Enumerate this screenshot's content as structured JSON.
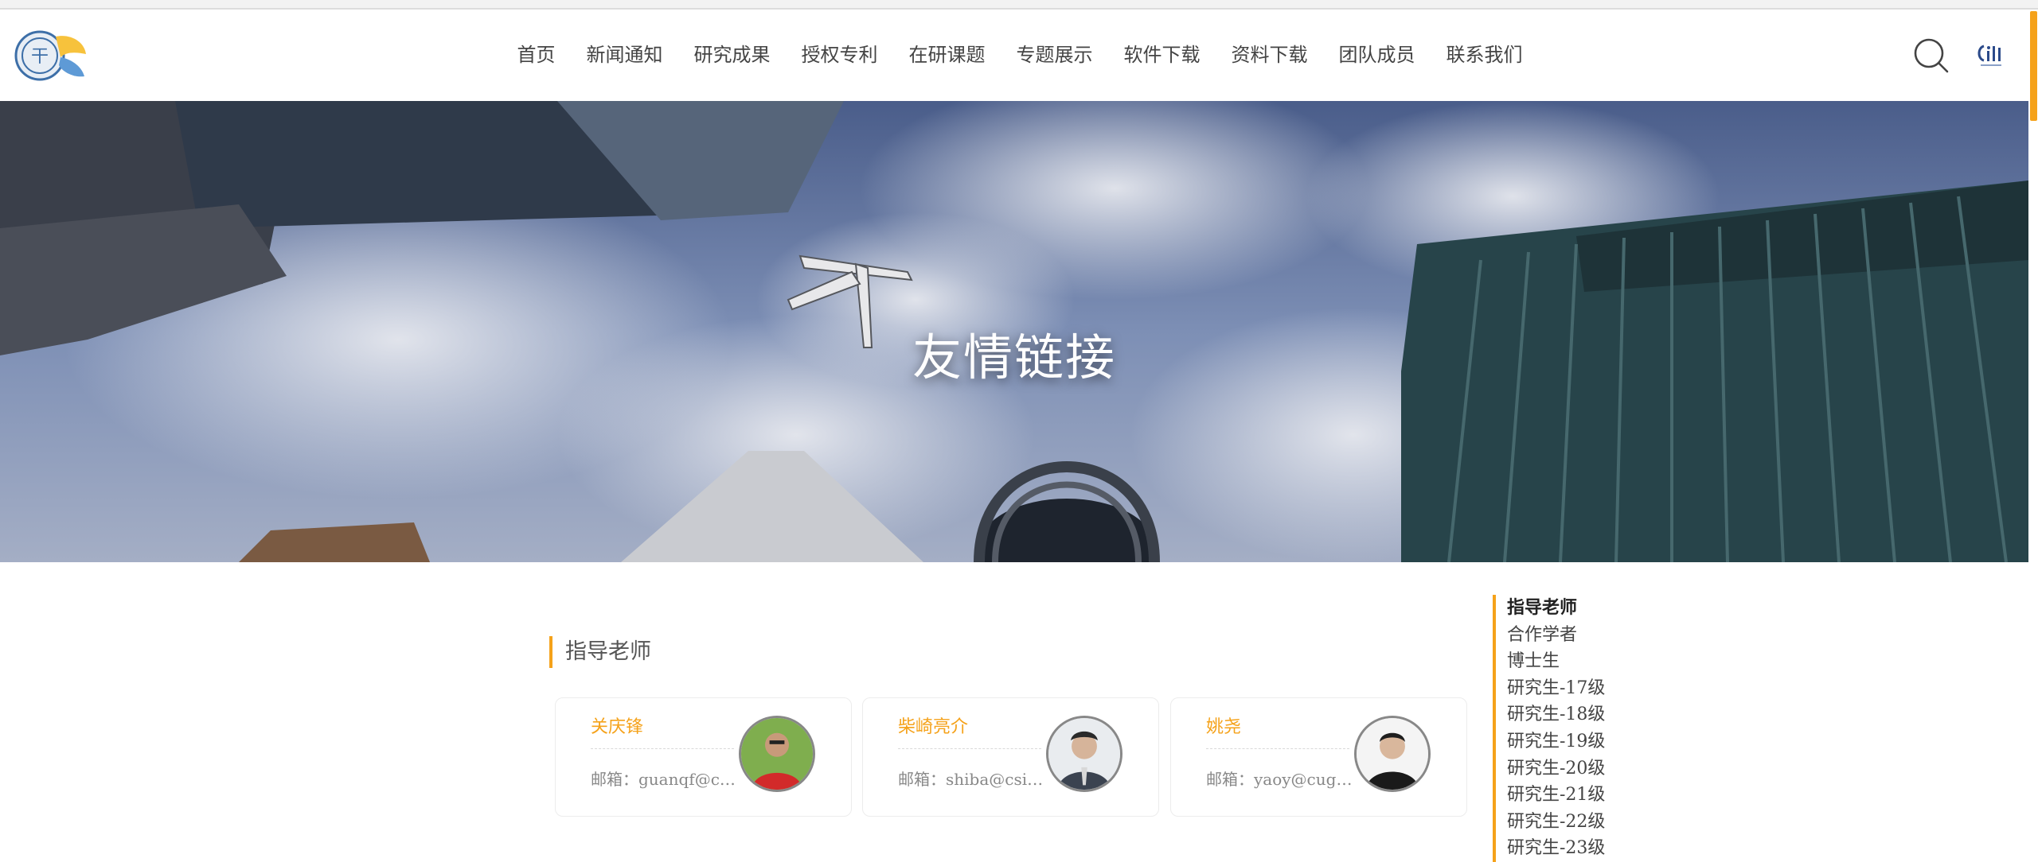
{
  "nav": {
    "items": [
      "首页",
      "新闻通知",
      "研究成果",
      "授权专利",
      "在研课题",
      "专题展示",
      "软件下载",
      "资料下载",
      "团队成员",
      "联系我们"
    ]
  },
  "icons": {
    "search": "search-icon",
    "logo": "university-logo",
    "partner_logo": "partner-logo"
  },
  "banner": {
    "title": "友情链接"
  },
  "section": {
    "title": "指导老师"
  },
  "people": [
    {
      "name": "关庆锋",
      "email": "邮箱：guanqf@cug.edu.cn"
    },
    {
      "name": "柴崎亮介",
      "email": "邮箱：shiba@csis.u-tokyo.ac.jp"
    },
    {
      "name": "姚尧",
      "email": "邮箱：yaoy@cug.edu.cn"
    }
  ],
  "sidebar": {
    "items": [
      "指导老师",
      "合作学者",
      "博士生",
      "研究生-17级",
      "研究生-18级",
      "研究生-19级",
      "研究生-20级",
      "研究生-21级",
      "研究生-22级",
      "研究生-23级"
    ]
  },
  "colors": {
    "accent": "#f5a21a",
    "text": "#444444"
  }
}
